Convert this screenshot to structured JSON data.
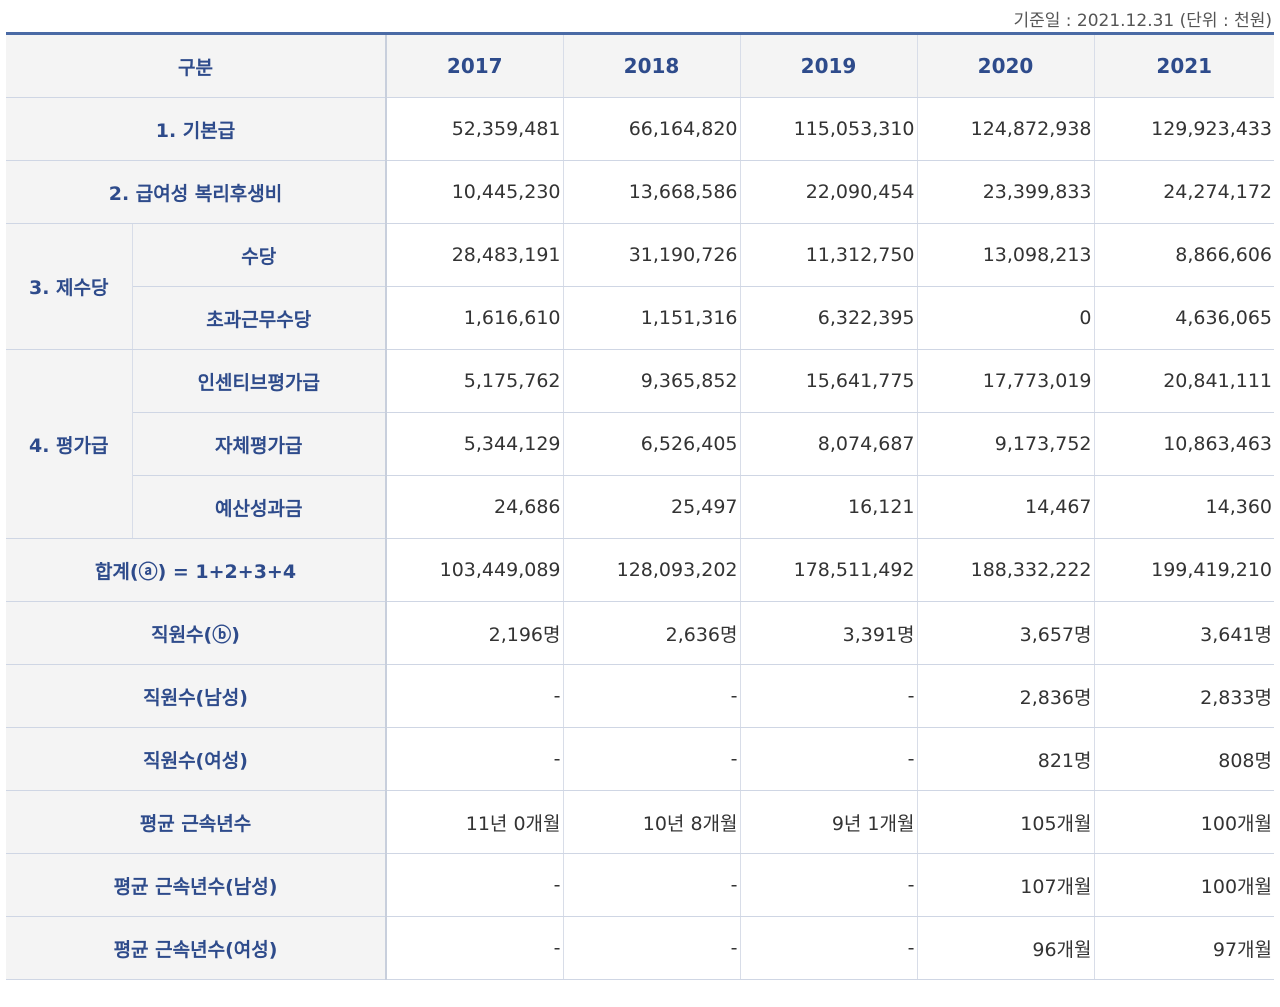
{
  "basis_note": "기준일 : 2021.12.31 (단위 : 천원)",
  "header": {
    "label": "구분",
    "years": [
      "2017",
      "2018",
      "2019",
      "2020",
      "2021"
    ]
  },
  "rows": {
    "basic_pay": {
      "label": "1. 기본급",
      "values": [
        "52,359,481",
        "66,164,820",
        "115,053,310",
        "124,872,938",
        "129,923,433"
      ]
    },
    "welfare": {
      "label": "2. 급여성 복리후생비",
      "values": [
        "10,445,230",
        "13,668,586",
        "22,090,454",
        "23,399,833",
        "24,274,172"
      ]
    },
    "allowance_group": "3. 제수당",
    "allowance": {
      "label": "수당",
      "values": [
        "28,483,191",
        "31,190,726",
        "11,312,750",
        "13,098,213",
        "8,866,606"
      ]
    },
    "overtime": {
      "label": "초과근무수당",
      "values": [
        "1,616,610",
        "1,151,316",
        "6,322,395",
        "0",
        "4,636,065"
      ]
    },
    "eval_group": "4. 평가급",
    "incentive": {
      "label": "인센티브평가급",
      "values": [
        "5,175,762",
        "9,365,852",
        "15,641,775",
        "17,773,019",
        "20,841,111"
      ]
    },
    "self_eval": {
      "label": "자체평가급",
      "values": [
        "5,344,129",
        "6,526,405",
        "8,074,687",
        "9,173,752",
        "10,863,463"
      ]
    },
    "budget_perf": {
      "label": "예산성과금",
      "values": [
        "24,686",
        "25,497",
        "16,121",
        "14,467",
        "14,360"
      ]
    },
    "total": {
      "label": "합계(ⓐ) = 1+2+3+4",
      "values": [
        "103,449,089",
        "128,093,202",
        "178,511,492",
        "188,332,222",
        "199,419,210"
      ]
    },
    "employees": {
      "label": "직원수(ⓑ)",
      "values": [
        "2,196명",
        "2,636명",
        "3,391명",
        "3,657명",
        "3,641명"
      ]
    },
    "employees_male": {
      "label": "직원수(남성)",
      "values": [
        "-",
        "-",
        "-",
        "2,836명",
        "2,833명"
      ]
    },
    "employees_female": {
      "label": "직원수(여성)",
      "values": [
        "-",
        "-",
        "-",
        "821명",
        "808명"
      ]
    },
    "avg_tenure": {
      "label": "평균 근속년수",
      "values": [
        "11년 0개월",
        "10년 8개월",
        "9년 1개월",
        "105개월",
        "100개월"
      ]
    },
    "avg_tenure_male": {
      "label": "평균 근속년수(남성)",
      "values": [
        "-",
        "-",
        "-",
        "107개월",
        "100개월"
      ]
    },
    "avg_tenure_female": {
      "label": "평균 근속년수(여성)",
      "values": [
        "-",
        "-",
        "-",
        "96개월",
        "97개월"
      ]
    }
  }
}
